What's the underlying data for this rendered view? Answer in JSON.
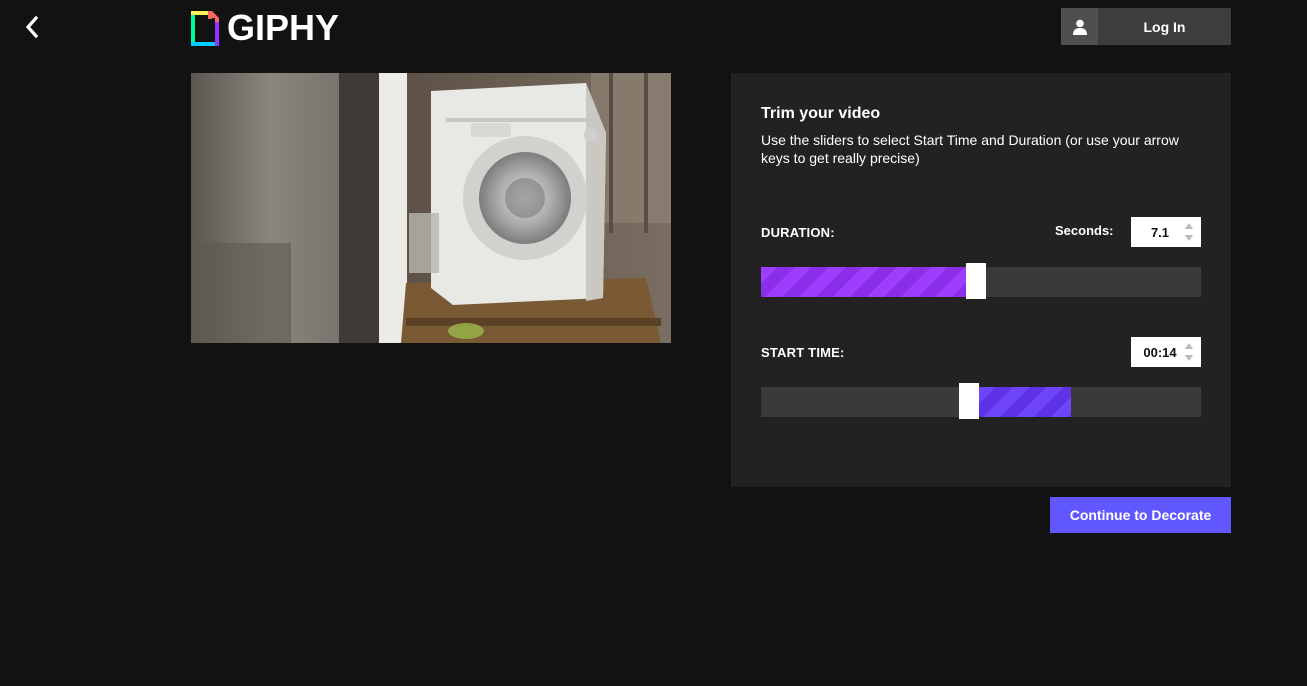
{
  "header": {
    "logo_text": "GIPHY",
    "login_label": "Log In"
  },
  "icons": {
    "back": "chevron-left-icon",
    "user": "user-icon",
    "logo": "giphy-logo-icon",
    "spinner_up": "caret-up-icon",
    "spinner_down": "caret-down-icon"
  },
  "trim": {
    "title": "Trim your video",
    "description": "Use the sliders to select Start Time and Duration (or use your arrow keys to get really precise)",
    "duration": {
      "label": "DURATION:",
      "seconds_label": "Seconds:",
      "value": "7.1",
      "slider_fraction": 0.47
    },
    "start_time": {
      "label": "START TIME:",
      "value": "00:14",
      "slider_fraction": 0.46,
      "selection_end_fraction": 0.705
    }
  },
  "actions": {
    "continue_label": "Continue to Decorate"
  },
  "colors": {
    "background": "#121212",
    "panel": "#222222",
    "track": "#3a3a3a",
    "duration_fill": "#9933ff",
    "start_fill": "#6b3cf5",
    "continue_button": "#6157ff",
    "login_button": "#3d3d3d"
  }
}
